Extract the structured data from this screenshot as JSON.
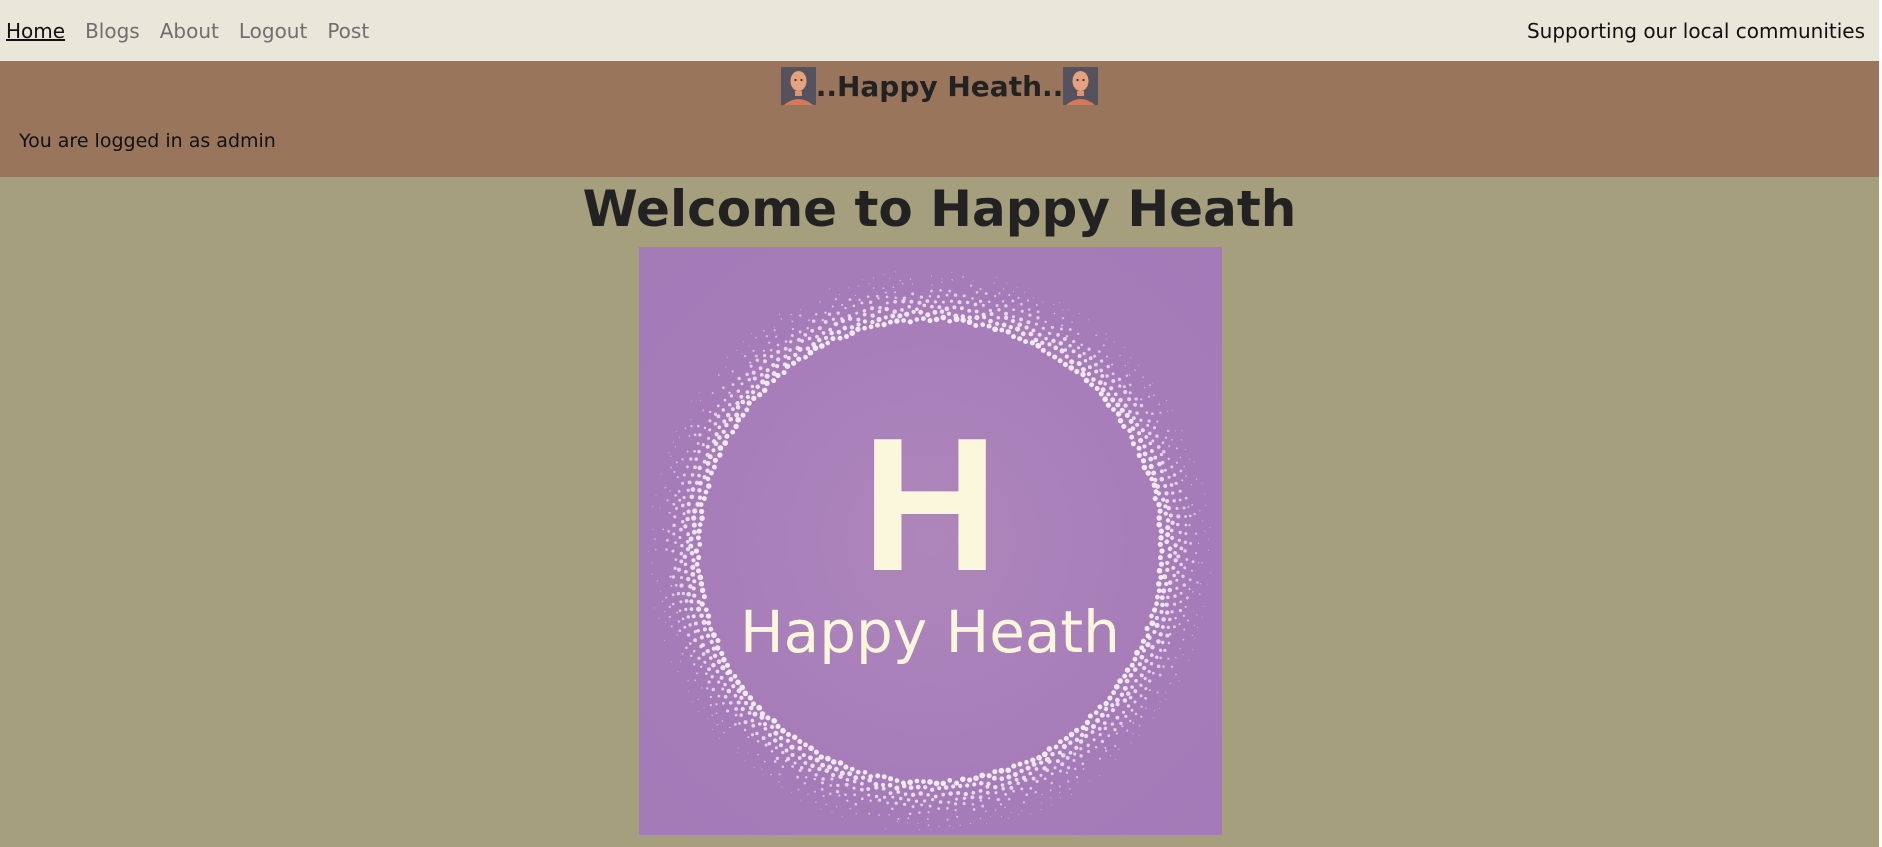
{
  "nav": {
    "links": [
      "Home",
      "Blogs",
      "About",
      "Logout",
      "Post"
    ],
    "active": "Home",
    "tagline": "Supporting our local communities"
  },
  "header": {
    "title": "..Happy Heath..",
    "login_status": "You are logged in as admin"
  },
  "main": {
    "heading": "Welcome to Happy Heath",
    "logo": {
      "letter": "H",
      "name": "Happy Heath",
      "bg_color": "#a67cb8",
      "text_color": "#fbf7dc"
    }
  },
  "colors": {
    "nav_bg": "#e9e6da",
    "header_bg": "#99755b",
    "page_bg": "#a59f7e"
  }
}
